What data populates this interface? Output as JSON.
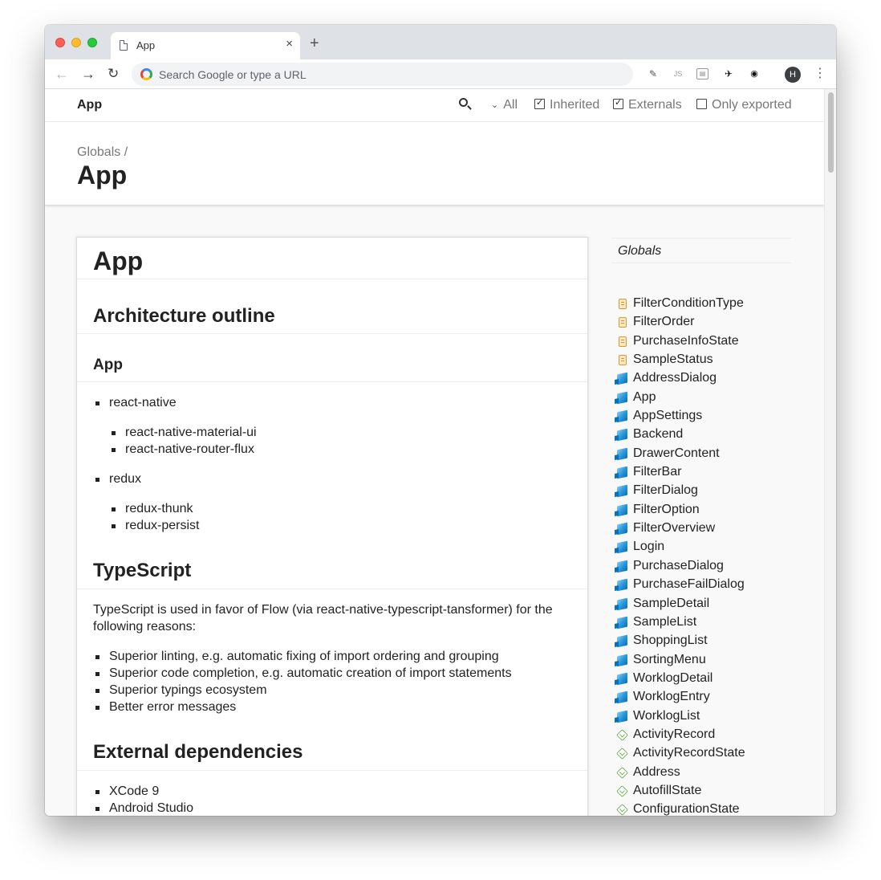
{
  "browser": {
    "tab_title": "App",
    "tab_close": "×",
    "new_tab": "+",
    "omnibox_placeholder": "Search Google or type a URL",
    "back": "←",
    "forward": "→",
    "reload": "↻",
    "profile_initial": "H",
    "menu": "⋮",
    "extensions": [
      {
        "name": "eyedropper-extension-icon",
        "glyph": "✎"
      },
      {
        "name": "js-extension-icon",
        "glyph": "JS"
      },
      {
        "name": "clipboard-extension-icon",
        "glyph": "▤"
      },
      {
        "name": "ninja-extension-icon",
        "glyph": "✈"
      },
      {
        "name": "mask-extension-icon",
        "glyph": "◉"
      }
    ]
  },
  "topbar": {
    "title": "App",
    "filters": {
      "all": "All",
      "inherited": "Inherited",
      "externals": "Externals",
      "only_exported": "Only exported"
    },
    "checkbox_state": {
      "inherited": true,
      "externals": true,
      "only_exported": false
    }
  },
  "header": {
    "breadcrumb": "Globals /",
    "title": "App"
  },
  "content": {
    "title": "App",
    "architecture_heading": "Architecture outline",
    "app_subheading": "App",
    "react_native": "react-native",
    "react_native_children": [
      "react-native-material-ui",
      "react-native-router-flux"
    ],
    "redux": "redux",
    "redux_children": [
      "redux-thunk",
      "redux-persist"
    ],
    "typescript_heading": "TypeScript",
    "typescript_paragraph": "TypeScript is used in favor of Flow (via react-native-typescript-tansformer) for the following reasons:",
    "typescript_reasons": [
      "Superior linting, e.g. automatic fixing of import ordering and grouping",
      "Superior code completion, e.g. automatic creation of import statements",
      "Superior typings ecosystem",
      "Better error messages"
    ],
    "external_heading": "External dependencies",
    "external_items": [
      "XCode 9",
      "Android Studio"
    ]
  },
  "sidebar": {
    "globals_label": "Globals",
    "items": [
      {
        "label": "FilterConditionType",
        "kind": "enum"
      },
      {
        "label": "FilterOrder",
        "kind": "enum"
      },
      {
        "label": "PurchaseInfoState",
        "kind": "enum"
      },
      {
        "label": "SampleStatus",
        "kind": "enum"
      },
      {
        "label": "AddressDialog",
        "kind": "class"
      },
      {
        "label": "App",
        "kind": "class"
      },
      {
        "label": "AppSettings",
        "kind": "class"
      },
      {
        "label": "Backend",
        "kind": "class"
      },
      {
        "label": "DrawerContent",
        "kind": "class"
      },
      {
        "label": "FilterBar",
        "kind": "class"
      },
      {
        "label": "FilterDialog",
        "kind": "class"
      },
      {
        "label": "FilterOption",
        "kind": "class"
      },
      {
        "label": "FilterOverview",
        "kind": "class"
      },
      {
        "label": "Login",
        "kind": "class"
      },
      {
        "label": "PurchaseDialog",
        "kind": "class"
      },
      {
        "label": "PurchaseFailDialog",
        "kind": "class"
      },
      {
        "label": "SampleDetail",
        "kind": "class"
      },
      {
        "label": "SampleList",
        "kind": "class"
      },
      {
        "label": "ShoppingList",
        "kind": "class"
      },
      {
        "label": "SortingMenu",
        "kind": "class"
      },
      {
        "label": "WorklogDetail",
        "kind": "class"
      },
      {
        "label": "WorklogEntry",
        "kind": "class"
      },
      {
        "label": "WorklogList",
        "kind": "class"
      },
      {
        "label": "ActivityRecord",
        "kind": "interface"
      },
      {
        "label": "ActivityRecordState",
        "kind": "interface"
      },
      {
        "label": "Address",
        "kind": "interface"
      },
      {
        "label": "AutofillState",
        "kind": "interface"
      },
      {
        "label": "ConfigurationState",
        "kind": "interface"
      }
    ]
  }
}
